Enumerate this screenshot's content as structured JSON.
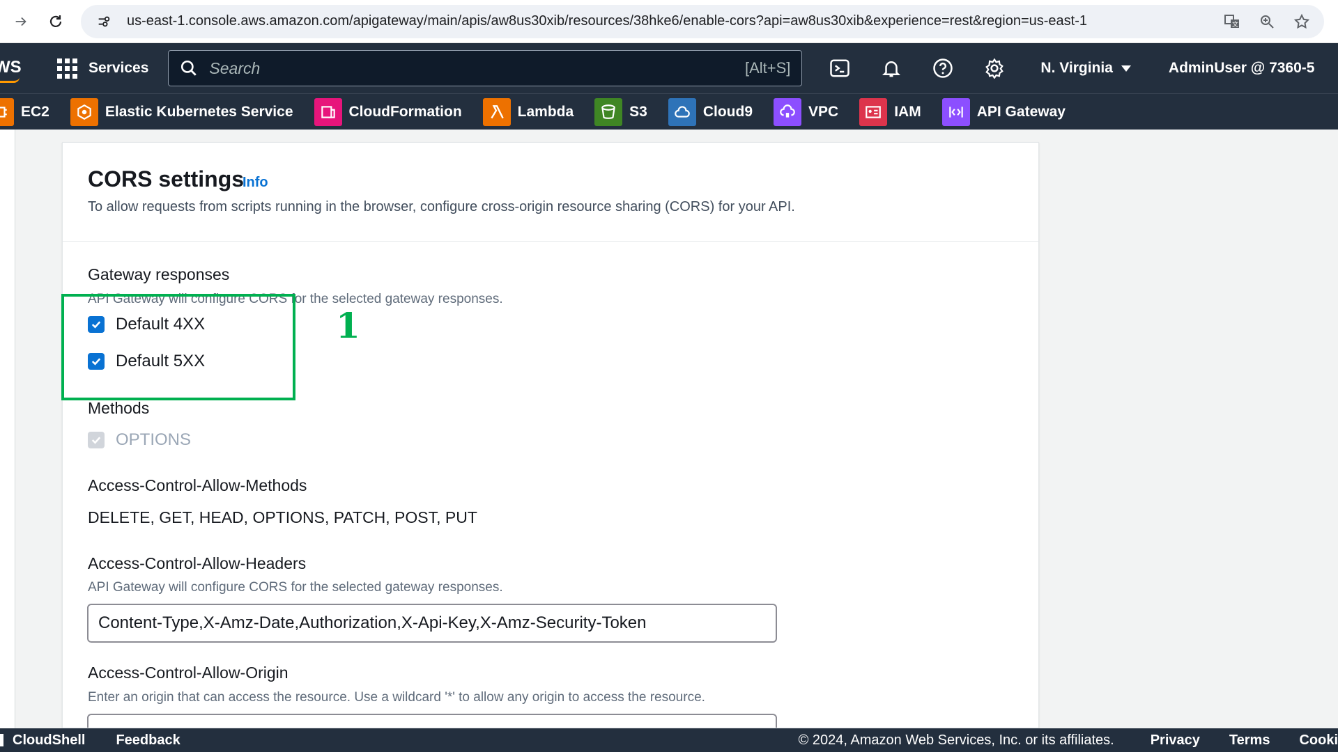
{
  "browser": {
    "url": "us-east-1.console.aws.amazon.com/apigateway/main/apis/aw8us30xib/resources/38hke6/enable-cors?api=aw8us30xib&experience=rest&region=us-east-1"
  },
  "aws_nav": {
    "logo_text": "WS",
    "services_label": "Services",
    "search_placeholder": "Search",
    "search_shortcut": "[Alt+S]",
    "region": "N. Virginia",
    "user": "AdminUser @ 7360-5"
  },
  "favorites": [
    {
      "label": "EC2",
      "color": "#ed7100",
      "icon": "ec2-icon"
    },
    {
      "label": "Elastic Kubernetes Service",
      "color": "#ed7100",
      "icon": "eks-icon"
    },
    {
      "label": "CloudFormation",
      "color": "#e7157b",
      "icon": "cloudformation-icon"
    },
    {
      "label": "Lambda",
      "color": "#ed7100",
      "icon": "lambda-icon"
    },
    {
      "label": "S3",
      "color": "#3f8624",
      "icon": "s3-icon"
    },
    {
      "label": "Cloud9",
      "color": "#2e73b8",
      "icon": "cloud9-icon"
    },
    {
      "label": "VPC",
      "color": "#8c4fff",
      "icon": "vpc-icon"
    },
    {
      "label": "IAM",
      "color": "#dd344c",
      "icon": "iam-icon"
    },
    {
      "label": "API Gateway",
      "color": "#8c4fff",
      "icon": "api-gateway-icon"
    }
  ],
  "cors": {
    "title": "CORS settings",
    "info_link": "Info",
    "description": "To allow requests from scripts running in the browser, configure cross-origin resource sharing (CORS) for your API.",
    "gateway_responses": {
      "label": "Gateway responses",
      "description": "API Gateway will configure CORS for the selected gateway responses.",
      "options": [
        {
          "label": "Default 4XX",
          "checked": true
        },
        {
          "label": "Default 5XX",
          "checked": true
        }
      ]
    },
    "methods": {
      "label": "Methods",
      "options": [
        {
          "label": "OPTIONS",
          "checked": true,
          "disabled": true
        }
      ]
    },
    "allow_methods": {
      "label": "Access-Control-Allow-Methods",
      "value": "DELETE, GET, HEAD, OPTIONS, PATCH, POST, PUT"
    },
    "allow_headers": {
      "label": "Access-Control-Allow-Headers",
      "description": "API Gateway will configure CORS for the selected gateway responses.",
      "value": "Content-Type,X-Amz-Date,Authorization,X-Api-Key,X-Amz-Security-Token"
    },
    "allow_origin": {
      "label": "Access-Control-Allow-Origin",
      "description": "Enter an origin that can access the resource. Use a wildcard '*' to allow any origin to access the resource."
    }
  },
  "annotation": {
    "number": "1",
    "color": "#00b050"
  },
  "footer": {
    "cloudshell": "CloudShell",
    "feedback": "Feedback",
    "copyright": "© 2024, Amazon Web Services, Inc. or its affiliates.",
    "links": [
      "Privacy",
      "Terms",
      "Cooki"
    ]
  }
}
